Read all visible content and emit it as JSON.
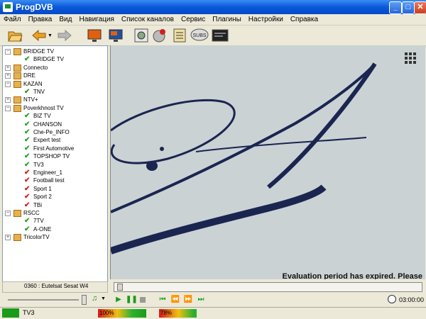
{
  "window": {
    "title": "ProgDVB",
    "minimize": "_",
    "maximize": "□",
    "close": "✕"
  },
  "menu": [
    "Файл",
    "Правка",
    "Вид",
    "Навигация",
    "Список каналов",
    "Сервис",
    "Плагины",
    "Настройки",
    "Справка"
  ],
  "toolbar": {
    "icons": [
      "open-folder-icon",
      "back-arrow-icon",
      "forward-arrow-icon",
      "tv-window-icon",
      "tv-fullscreen-icon",
      "settings-icon",
      "record-icon",
      "epg-icon",
      "subtitles-icon",
      "teletext-icon"
    ],
    "subs_label": "SUBS"
  },
  "tree": [
    {
      "type": "group",
      "label": "BRIDGE TV",
      "expanded": true
    },
    {
      "type": "channel",
      "label": "BRIDGE TV",
      "status": "ok"
    },
    {
      "type": "group",
      "label": "Connecto",
      "expanded": false
    },
    {
      "type": "group",
      "label": "DRE",
      "expanded": false
    },
    {
      "type": "group",
      "label": "KAZAN",
      "expanded": true
    },
    {
      "type": "channel",
      "label": "TNV",
      "status": "ok"
    },
    {
      "type": "group",
      "label": "NTV+",
      "expanded": false
    },
    {
      "type": "group",
      "label": "Poverkhnost TV",
      "expanded": true
    },
    {
      "type": "channel",
      "label": "BIZ TV",
      "status": "ok"
    },
    {
      "type": "channel",
      "label": "CHANSON",
      "status": "ok"
    },
    {
      "type": "channel",
      "label": "Che-Pe_INFO",
      "status": "ok"
    },
    {
      "type": "channel",
      "label": "Expert test",
      "status": "ok"
    },
    {
      "type": "channel",
      "label": "First Automotive",
      "status": "ok"
    },
    {
      "type": "channel",
      "label": "TOPSHOP TV",
      "status": "ok"
    },
    {
      "type": "channel",
      "label": "TV3",
      "status": "ok"
    },
    {
      "type": "channel",
      "label": "Engineer_1",
      "status": "bad"
    },
    {
      "type": "channel",
      "label": "Football test",
      "status": "bad"
    },
    {
      "type": "channel",
      "label": "Sport 1",
      "status": "bad"
    },
    {
      "type": "channel",
      "label": "Sport 2",
      "status": "bad"
    },
    {
      "type": "channel",
      "label": "TBi",
      "status": "bad"
    },
    {
      "type": "group",
      "label": "RSCC",
      "expanded": true
    },
    {
      "type": "channel",
      "label": "7TV",
      "status": "ok"
    },
    {
      "type": "channel",
      "label": "A-ONE",
      "status": "ok"
    },
    {
      "type": "group",
      "label": "TricolorTV",
      "expanded": false
    }
  ],
  "satellite": {
    "label": "0360 : Eutelsat Sesat  W4"
  },
  "video": {
    "overlay_text": "Evaluation period has expired. Please"
  },
  "player": {
    "time": "03:00:00"
  },
  "status": {
    "channel": "TV3",
    "signal_level": "100%",
    "signal_level_value": 1.0,
    "quality_level": "78%",
    "quality_level_value": 0.78
  }
}
